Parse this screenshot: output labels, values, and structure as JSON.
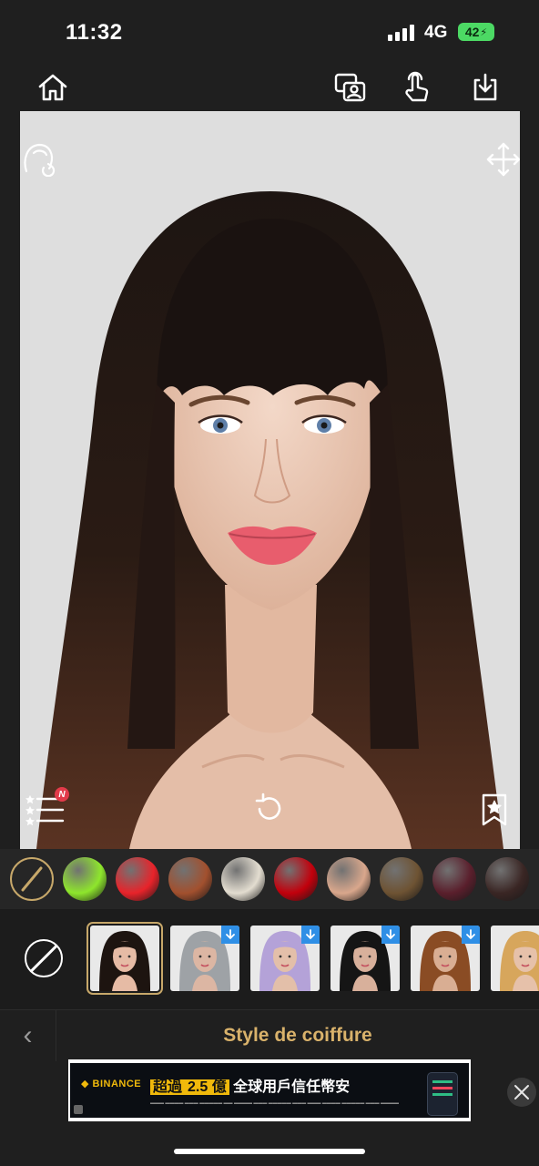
{
  "status": {
    "time": "11:32",
    "network": "4G",
    "battery": "42"
  },
  "toolbar": {
    "home_icon": "home-icon",
    "compare_icon": "compare-photos-icon",
    "touch_icon": "touch-hand-icon",
    "save_icon": "download-icon"
  },
  "photo_overlay": {
    "hair_edit_icon": "head-hair-icon",
    "move_icon": "move-arrows-icon",
    "list_icon": "ranked-list-icon",
    "list_badge": "N",
    "reset_icon": "rotate-reset-icon",
    "bookmark_icon": "bookmark-star-icon"
  },
  "colors": {
    "swatches": [
      "#8ee62c",
      "#e8232a",
      "#a2502e",
      "#e3ddd0",
      "#c2000c",
      "#d9a78c",
      "#6e5333",
      "#5a1f2c",
      "#3a2624"
    ],
    "none_accent": "#c7a86a"
  },
  "hairstyles": {
    "items": [
      {
        "hair": "#1d1410",
        "skin": "#e6bba5",
        "selected": true,
        "download": false
      },
      {
        "hair": "#9ea2a6",
        "skin": "#dcb6a3",
        "selected": false,
        "download": true
      },
      {
        "hair": "#b4a2d8",
        "skin": "#e3bfa9",
        "selected": false,
        "download": true
      },
      {
        "hair": "#151515",
        "skin": "#d8b09b",
        "selected": false,
        "download": true
      },
      {
        "hair": "#8a4c24",
        "skin": "#d9ae93",
        "selected": false,
        "download": true
      },
      {
        "hair": "#d7a65c",
        "skin": "#e6c1aa",
        "selected": false,
        "download": false
      }
    ]
  },
  "panel": {
    "back_label": "‹",
    "title": "Style de coiffure"
  },
  "ad": {
    "brand": "BINANCE",
    "headline_prefix": "超過",
    "headline_highlight": "2.5 億",
    "headline_suffix": "全球用戶信任幣安"
  }
}
